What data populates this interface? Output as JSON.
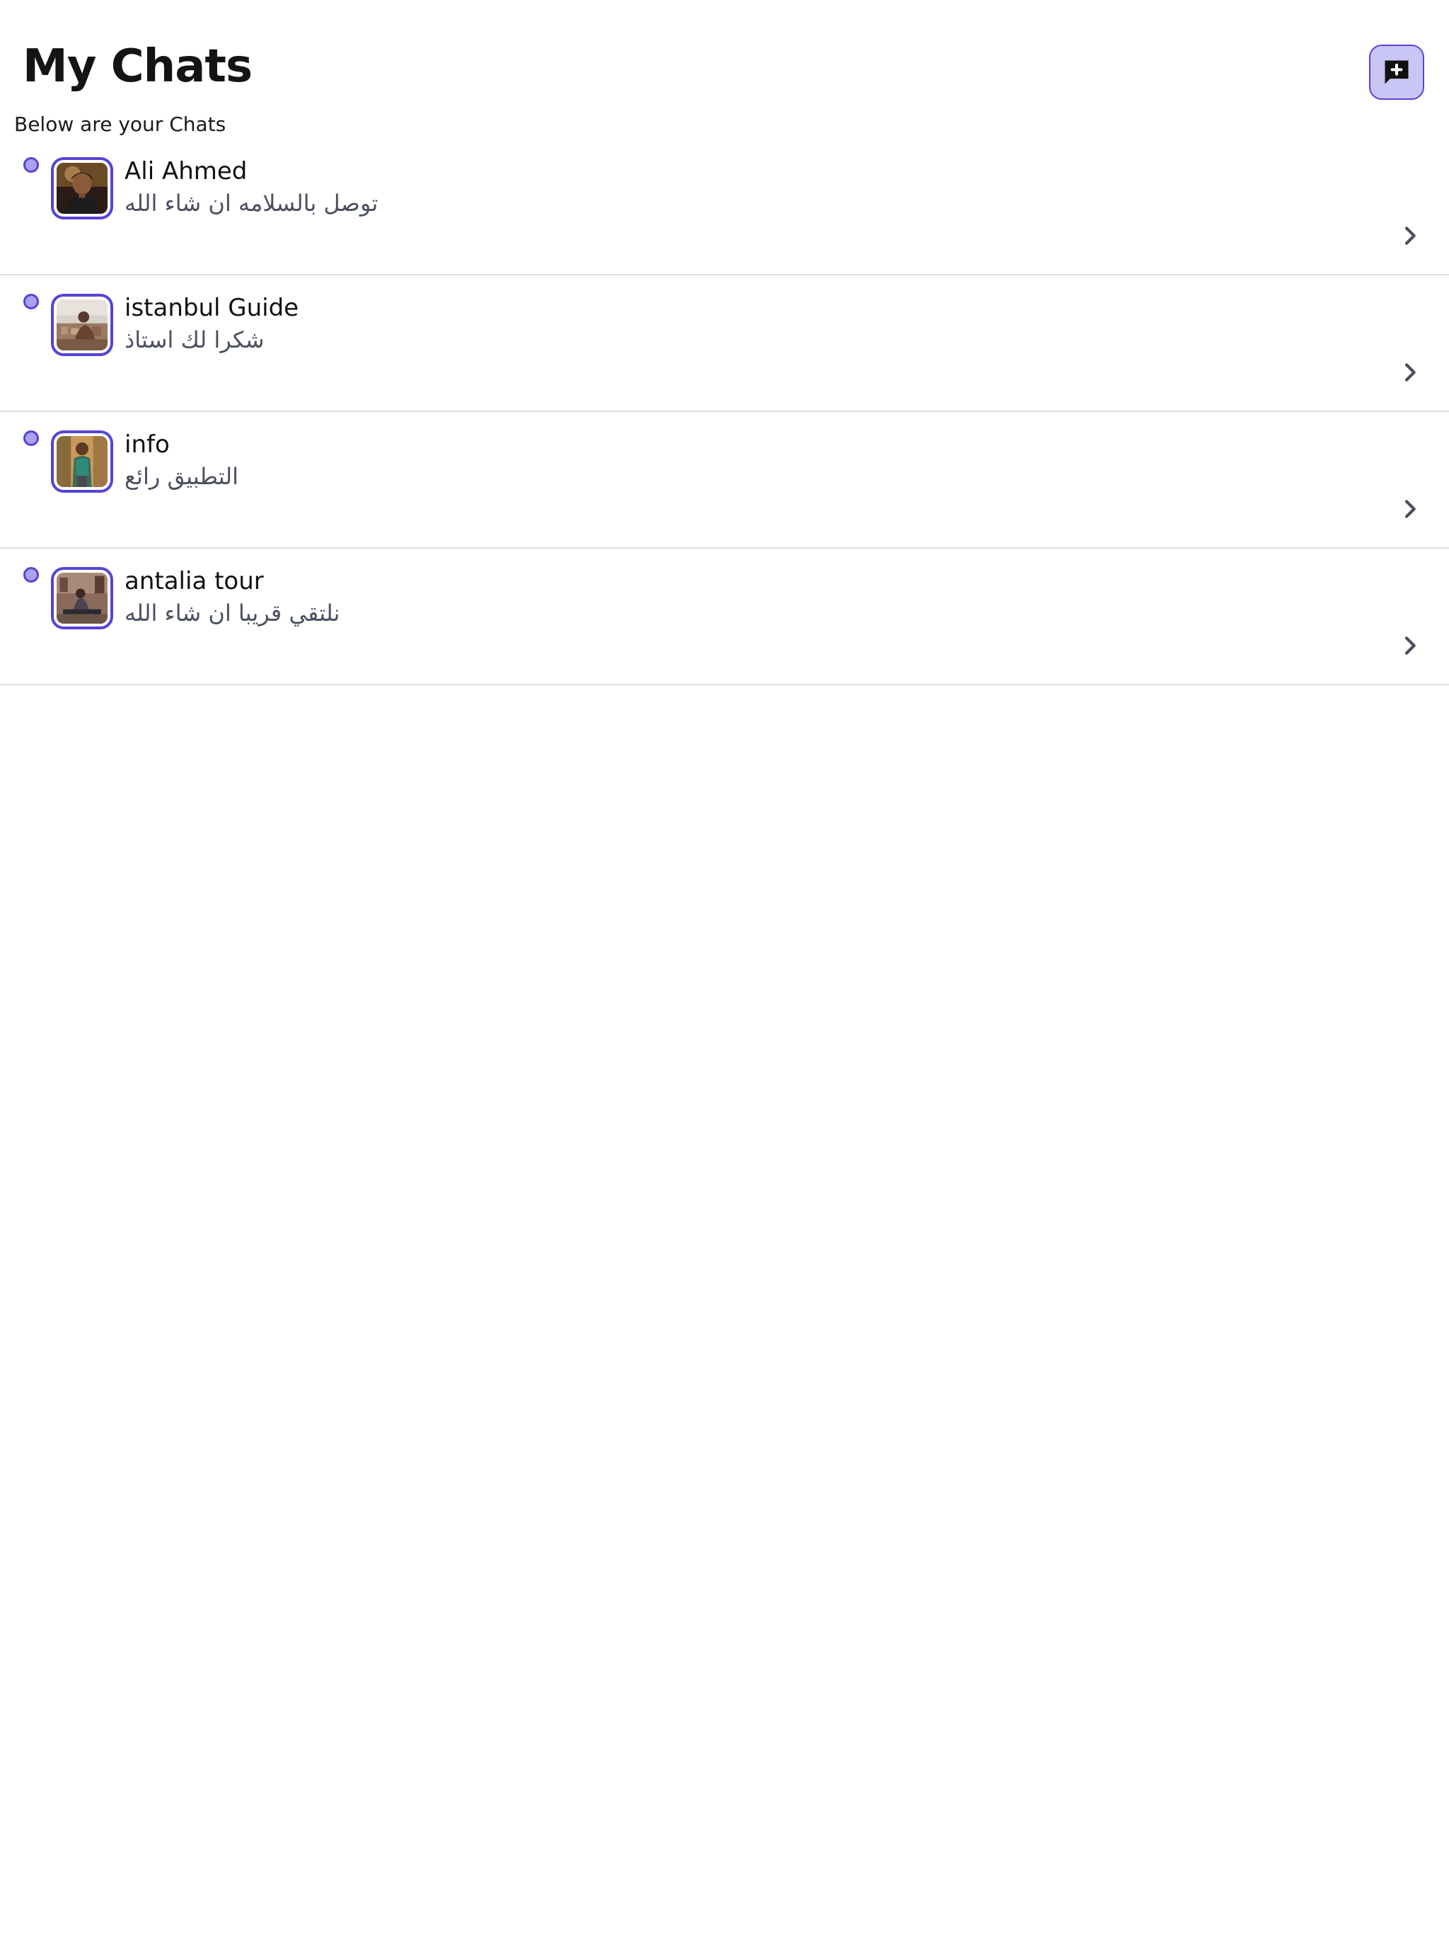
{
  "header": {
    "title": "My Chats",
    "subtitle": "Below are your Chats",
    "new_chat_icon": "add-comment-icon"
  },
  "colors": {
    "accent": "#5544d6",
    "accent_light": "#c9c5f5",
    "divider": "#dedede",
    "preview_text": "#4a5060"
  },
  "chats": [
    {
      "name": "Ali Ahmed",
      "preview": "توصل بالسلامه ان شاء الله",
      "avatar": "portrait-photo",
      "unread": true
    },
    {
      "name": "istanbul Guide",
      "preview": "شكرا لك استاذ",
      "avatar": "city-landscape-photo",
      "unread": true
    },
    {
      "name": "info",
      "preview": "التطبيق رائع",
      "avatar": "backpacker-photo",
      "unread": true
    },
    {
      "name": "antalia tour",
      "preview": "نلتقي قريبا ان شاء الله",
      "avatar": "street-scene-photo",
      "unread": true
    }
  ]
}
